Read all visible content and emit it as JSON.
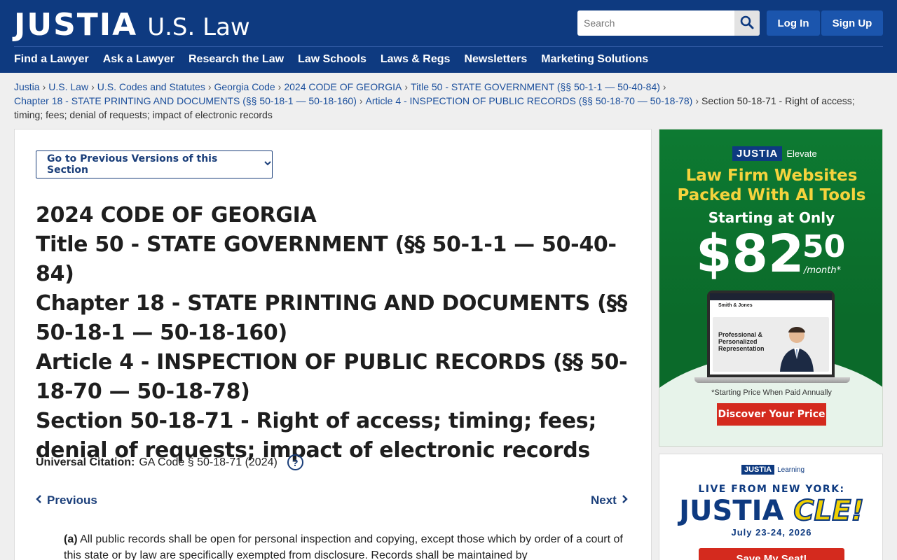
{
  "header": {
    "logo_main": "JUSTIA",
    "logo_sub": "U.S. Law",
    "search_placeholder": "Search",
    "login_label": "Log In",
    "signup_label": "Sign Up"
  },
  "nav": [
    "Find a Lawyer",
    "Ask a Lawyer",
    "Research the Law",
    "Law Schools",
    "Laws & Regs",
    "Newsletters",
    "Marketing Solutions"
  ],
  "breadcrumb": [
    "Justia",
    "U.S. Law",
    "U.S. Codes and Statutes",
    "Georgia Code",
    "2024 CODE OF GEORGIA",
    "Title 50 - STATE GOVERNMENT (§§ 50-1-1 — 50-40-84)",
    "Chapter 18 - STATE PRINTING AND DOCUMENTS (§§ 50-18-1 — 50-18-160)",
    "Article 4 - INSPECTION OF PUBLIC RECORDS (§§ 50-18-70 — 50-18-78)"
  ],
  "breadcrumb_current": "Section 50-18-71 - Right of access; timing; fees; denial of requests; impact of electronic records",
  "main": {
    "prev_versions_label": "Go to Previous Versions of this Section",
    "headings": [
      "2024 CODE OF GEORGIA",
      "Title 50 - STATE GOVERNMENT (§§ 50-1-1 — 50-40-84)",
      "Chapter 18 - STATE PRINTING AND DOCUMENTS (§§ 50-18-1 — 50-18-160)",
      "Article 4 - INSPECTION OF PUBLIC RECORDS (§§ 50-18-70 — 50-18-78)",
      "Section 50-18-71 - Right of access; timing; fees; denial of requests; impact of electronic records"
    ],
    "citation_label": "Universal Citation:",
    "citation_value": "GA Code § 50-18-71 (2024)",
    "help_symbol": "?",
    "previous_label": "Previous",
    "next_label": "Next",
    "para_a_label": "(a)",
    "para_a_text": "All public records shall be open for personal inspection and copying, except those which by order of a court of this state or by law are specifically exempted from disclosure. Records shall be maintained by"
  },
  "ad1": {
    "brand": "JUSTIA",
    "brand_suffix": "Elevate",
    "title": "Law Firm Websites Packed With AI Tools",
    "starting": "Starting at Only",
    "price_dollar": "$82",
    "price_cents": "50",
    "price_period": "/month*",
    "screen_logo": "Smith & Jones",
    "screen_hero": "Professional & Personalized Representation",
    "note": "*Starting Price When Paid Annually",
    "button": "Discover Your Price"
  },
  "ad2": {
    "brand": "JUSTIA",
    "brand_suffix": "Learning",
    "live": "LIVE FROM NEW YORK:",
    "title_main": "JUSTIA",
    "title_accent": "CLE!",
    "date": "July 23-24, 2026",
    "button": "Save My Seat!"
  },
  "colors": {
    "header_bg": "#0e3a80",
    "button_blue": "#1b55ad",
    "link": "#1b4f9c",
    "ad_green": "#0b6a2a",
    "ad_yellow": "#f5d33d",
    "cta_red": "#d42a1e"
  }
}
